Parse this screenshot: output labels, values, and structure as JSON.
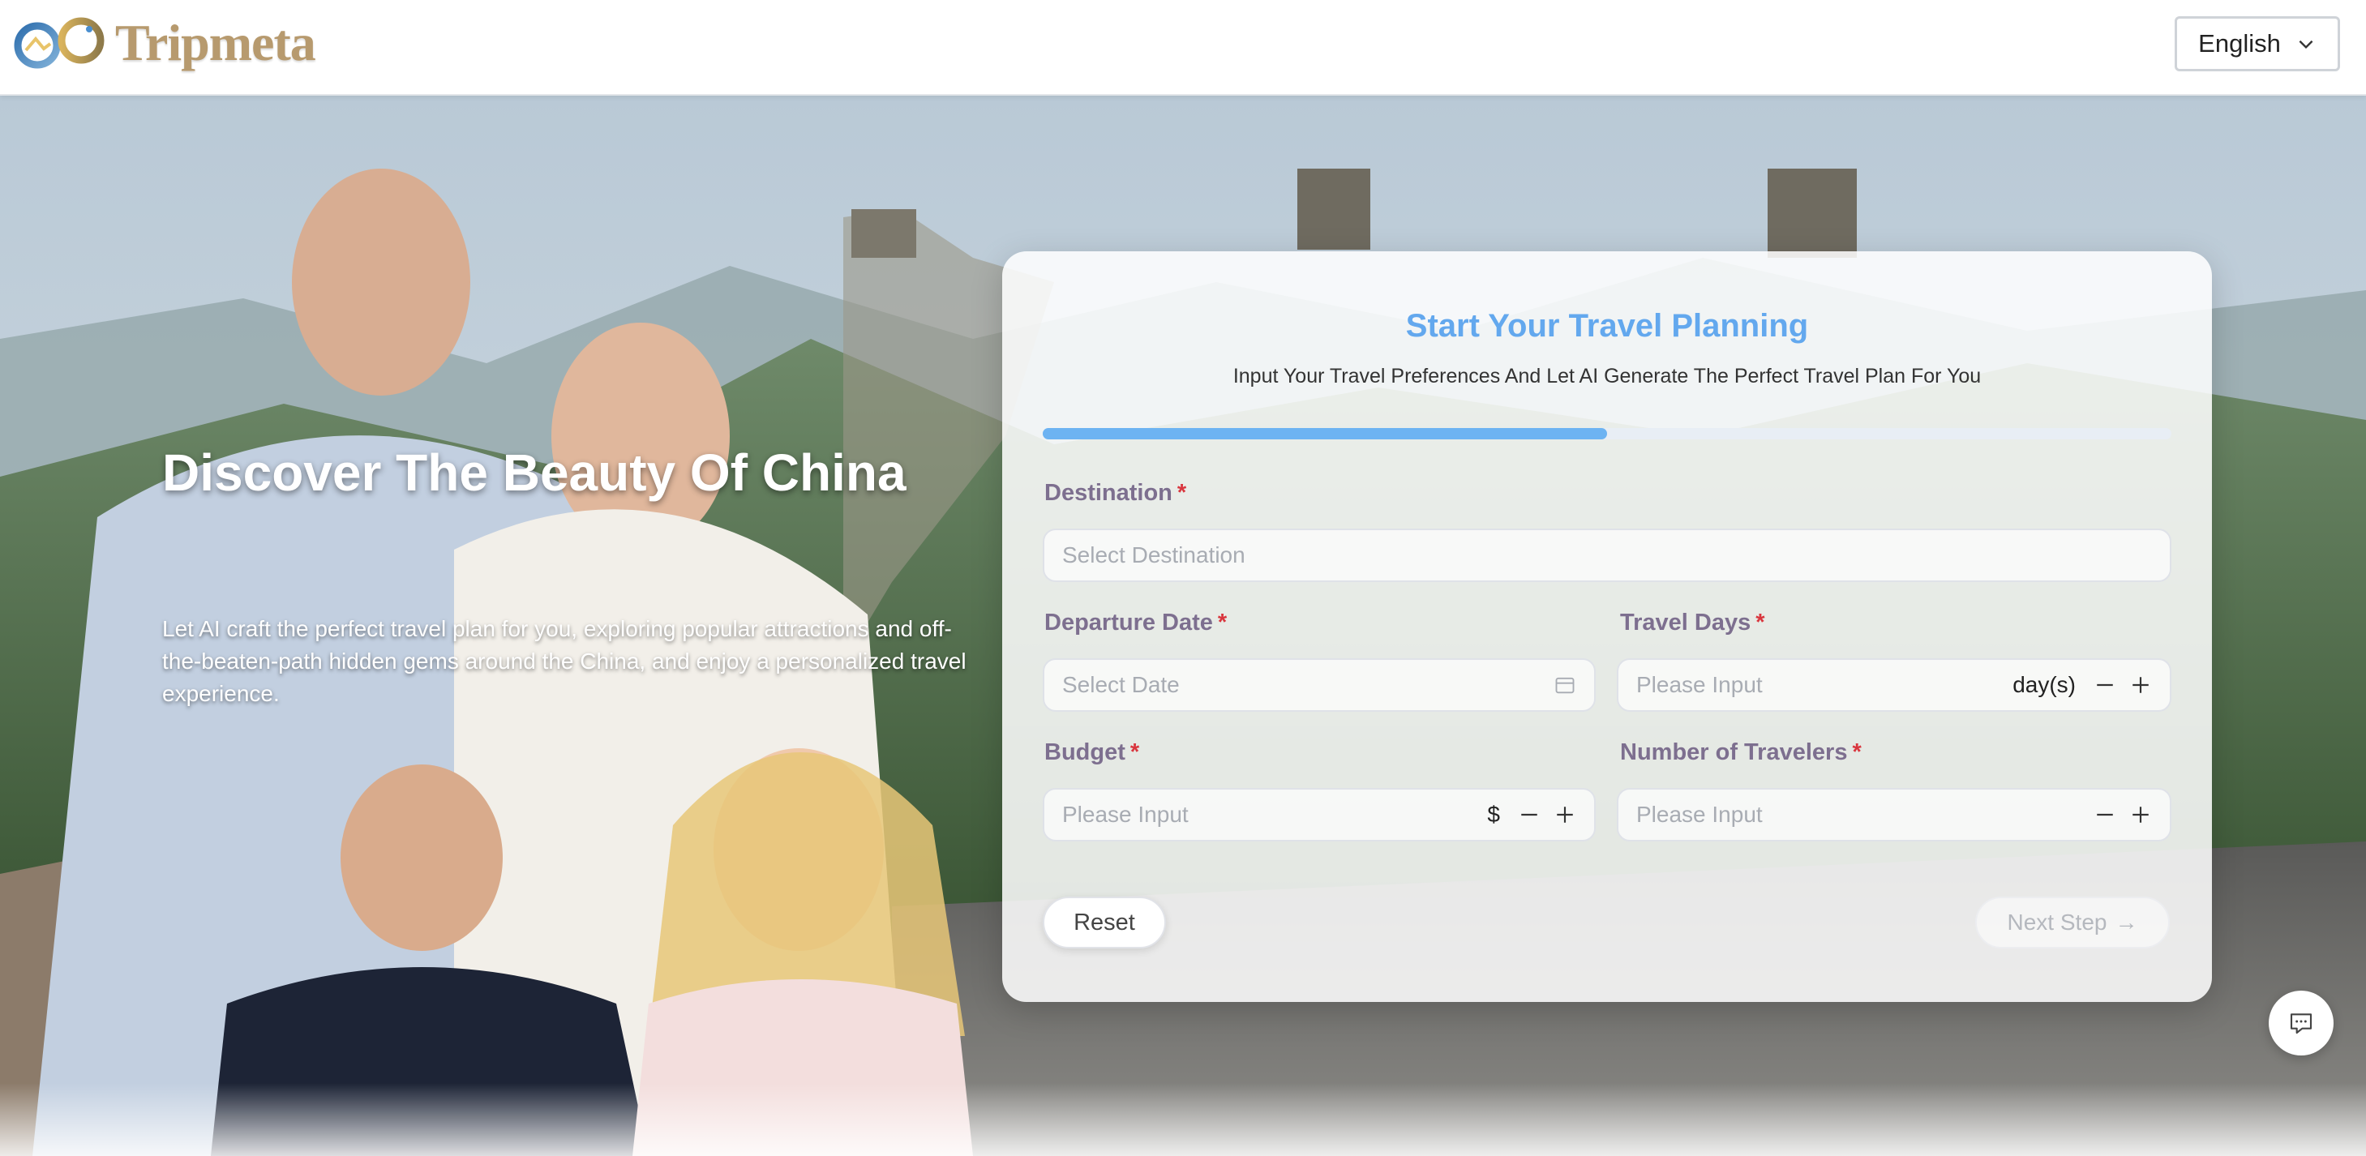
{
  "header": {
    "brand_name": "Tripmeta",
    "language_button": "English"
  },
  "hero": {
    "title": "Discover The Beauty Of China",
    "description": "Let AI craft the perfect travel plan for you, exploring popular attractions and off-the-beaten-path hidden gems around the China, and enjoy a personalized travel experience."
  },
  "form": {
    "title": "Start Your Travel Planning",
    "subtitle": "Input Your Travel Preferences And Let AI Generate The Perfect Travel Plan For You",
    "progress_fraction": 0.5,
    "required_mark": "*",
    "destination": {
      "label": "Destination",
      "placeholder": "Select Destination",
      "value": ""
    },
    "departure_date": {
      "label": "Departure Date",
      "placeholder": "Select Date",
      "value": ""
    },
    "travel_days": {
      "label": "Travel Days",
      "placeholder": "Please Input",
      "suffix": "day(s)",
      "value": ""
    },
    "budget": {
      "label": "Budget",
      "placeholder": "Please Input",
      "suffix": "$",
      "value": ""
    },
    "travelers": {
      "label": "Number of Travelers",
      "placeholder": "Please Input",
      "value": ""
    },
    "reset_label": "Reset",
    "next_label": "Next Step",
    "next_arrow": "→"
  },
  "colors": {
    "accent": "#63a8ee",
    "progress": "#6db3f2",
    "label": "#7d6f8f",
    "required": "#d9363e",
    "brand": "#b79a6e"
  },
  "icons": {
    "logo": "infinity-logo-icon",
    "language_dropdown": "chevron-down-icon",
    "calendar": "calendar-icon",
    "minus": "minus-icon",
    "plus": "plus-icon",
    "chat": "chat-bubble-icon"
  }
}
